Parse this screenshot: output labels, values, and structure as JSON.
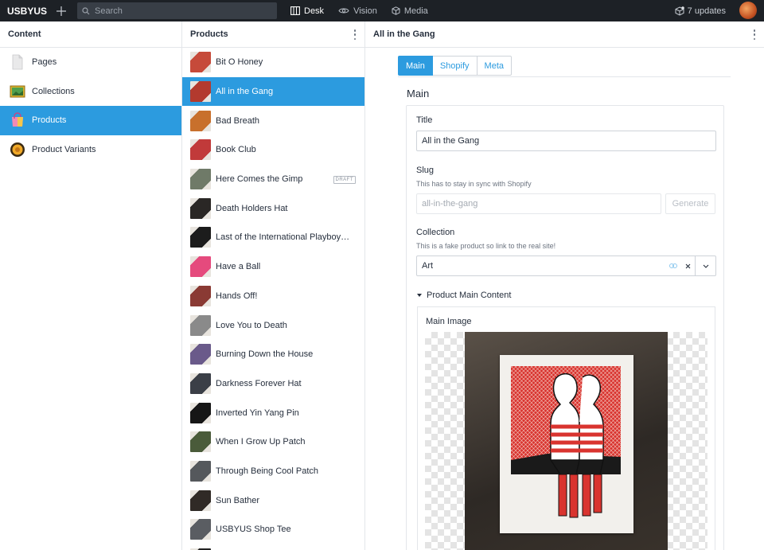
{
  "topbar": {
    "brand": "USBYUS",
    "search_placeholder": "Search",
    "tools": [
      {
        "label": "Desk",
        "icon": "desk-icon"
      },
      {
        "label": "Vision",
        "icon": "eye-icon"
      },
      {
        "label": "Media",
        "icon": "cube-icon"
      }
    ],
    "updates_label": "7 updates"
  },
  "content_pane": {
    "title": "Content",
    "items": [
      {
        "label": "Pages",
        "icon": "page-icon"
      },
      {
        "label": "Collections",
        "icon": "collections-icon"
      },
      {
        "label": "Products",
        "icon": "products-icon"
      },
      {
        "label": "Product Variants",
        "icon": "variants-icon"
      }
    ],
    "selected_index": 2
  },
  "products_pane": {
    "title": "Products",
    "selected_index": 1,
    "draft_label": "DRAFT",
    "items": [
      {
        "label": "Bit O Honey",
        "thumb_color": "#c64a3a"
      },
      {
        "label": "All in the Gang",
        "thumb_color": "#b33a2e"
      },
      {
        "label": "Bad Breath",
        "thumb_color": "#c8702c"
      },
      {
        "label": "Book Club",
        "thumb_color": "#c13a3a"
      },
      {
        "label": "Here Comes the Gimp",
        "thumb_color": "#6f7a68",
        "draft": true
      },
      {
        "label": "Death Holders Hat",
        "thumb_color": "#2a2725"
      },
      {
        "label": "Last of the International Playboys …",
        "thumb_color": "#1c1c1c"
      },
      {
        "label": "Have a Ball",
        "thumb_color": "#e54a7d"
      },
      {
        "label": "Hands Off!",
        "thumb_color": "#8a3a34"
      },
      {
        "label": "Love You to Death",
        "thumb_color": "#8a8a8a"
      },
      {
        "label": "Burning Down the House",
        "thumb_color": "#6a5a8a"
      },
      {
        "label": "Darkness Forever Hat",
        "thumb_color": "#3b3f47"
      },
      {
        "label": "Inverted Yin Yang Pin",
        "thumb_color": "#161616"
      },
      {
        "label": "When I Grow Up Patch",
        "thumb_color": "#4a5b3a"
      },
      {
        "label": "Through Being Cool Patch",
        "thumb_color": "#55585c"
      },
      {
        "label": "Sun Bather",
        "thumb_color": "#302a26"
      },
      {
        "label": "USBYUS Shop Tee",
        "thumb_color": "#5a5d62"
      },
      {
        "label": "",
        "thumb_color": "#222222"
      }
    ]
  },
  "doc_pane": {
    "title": "All in the Gang",
    "tabs": [
      "Main",
      "Shopify",
      "Meta"
    ],
    "section_title": "Main",
    "title_field": {
      "label": "Title",
      "value": "All in the Gang"
    },
    "slug_field": {
      "label": "Slug",
      "description": "This has to stay in sync with Shopify",
      "value": "all-in-the-gang",
      "button": "Generate"
    },
    "collection_field": {
      "label": "Collection",
      "description": "This is a fake product so link to the real site!",
      "value": "Art"
    },
    "fieldset_title": "Product Main Content",
    "main_image_label": "Main Image"
  },
  "colors": {
    "accent": "#2c9bdf",
    "topbar": "#1d2126"
  }
}
